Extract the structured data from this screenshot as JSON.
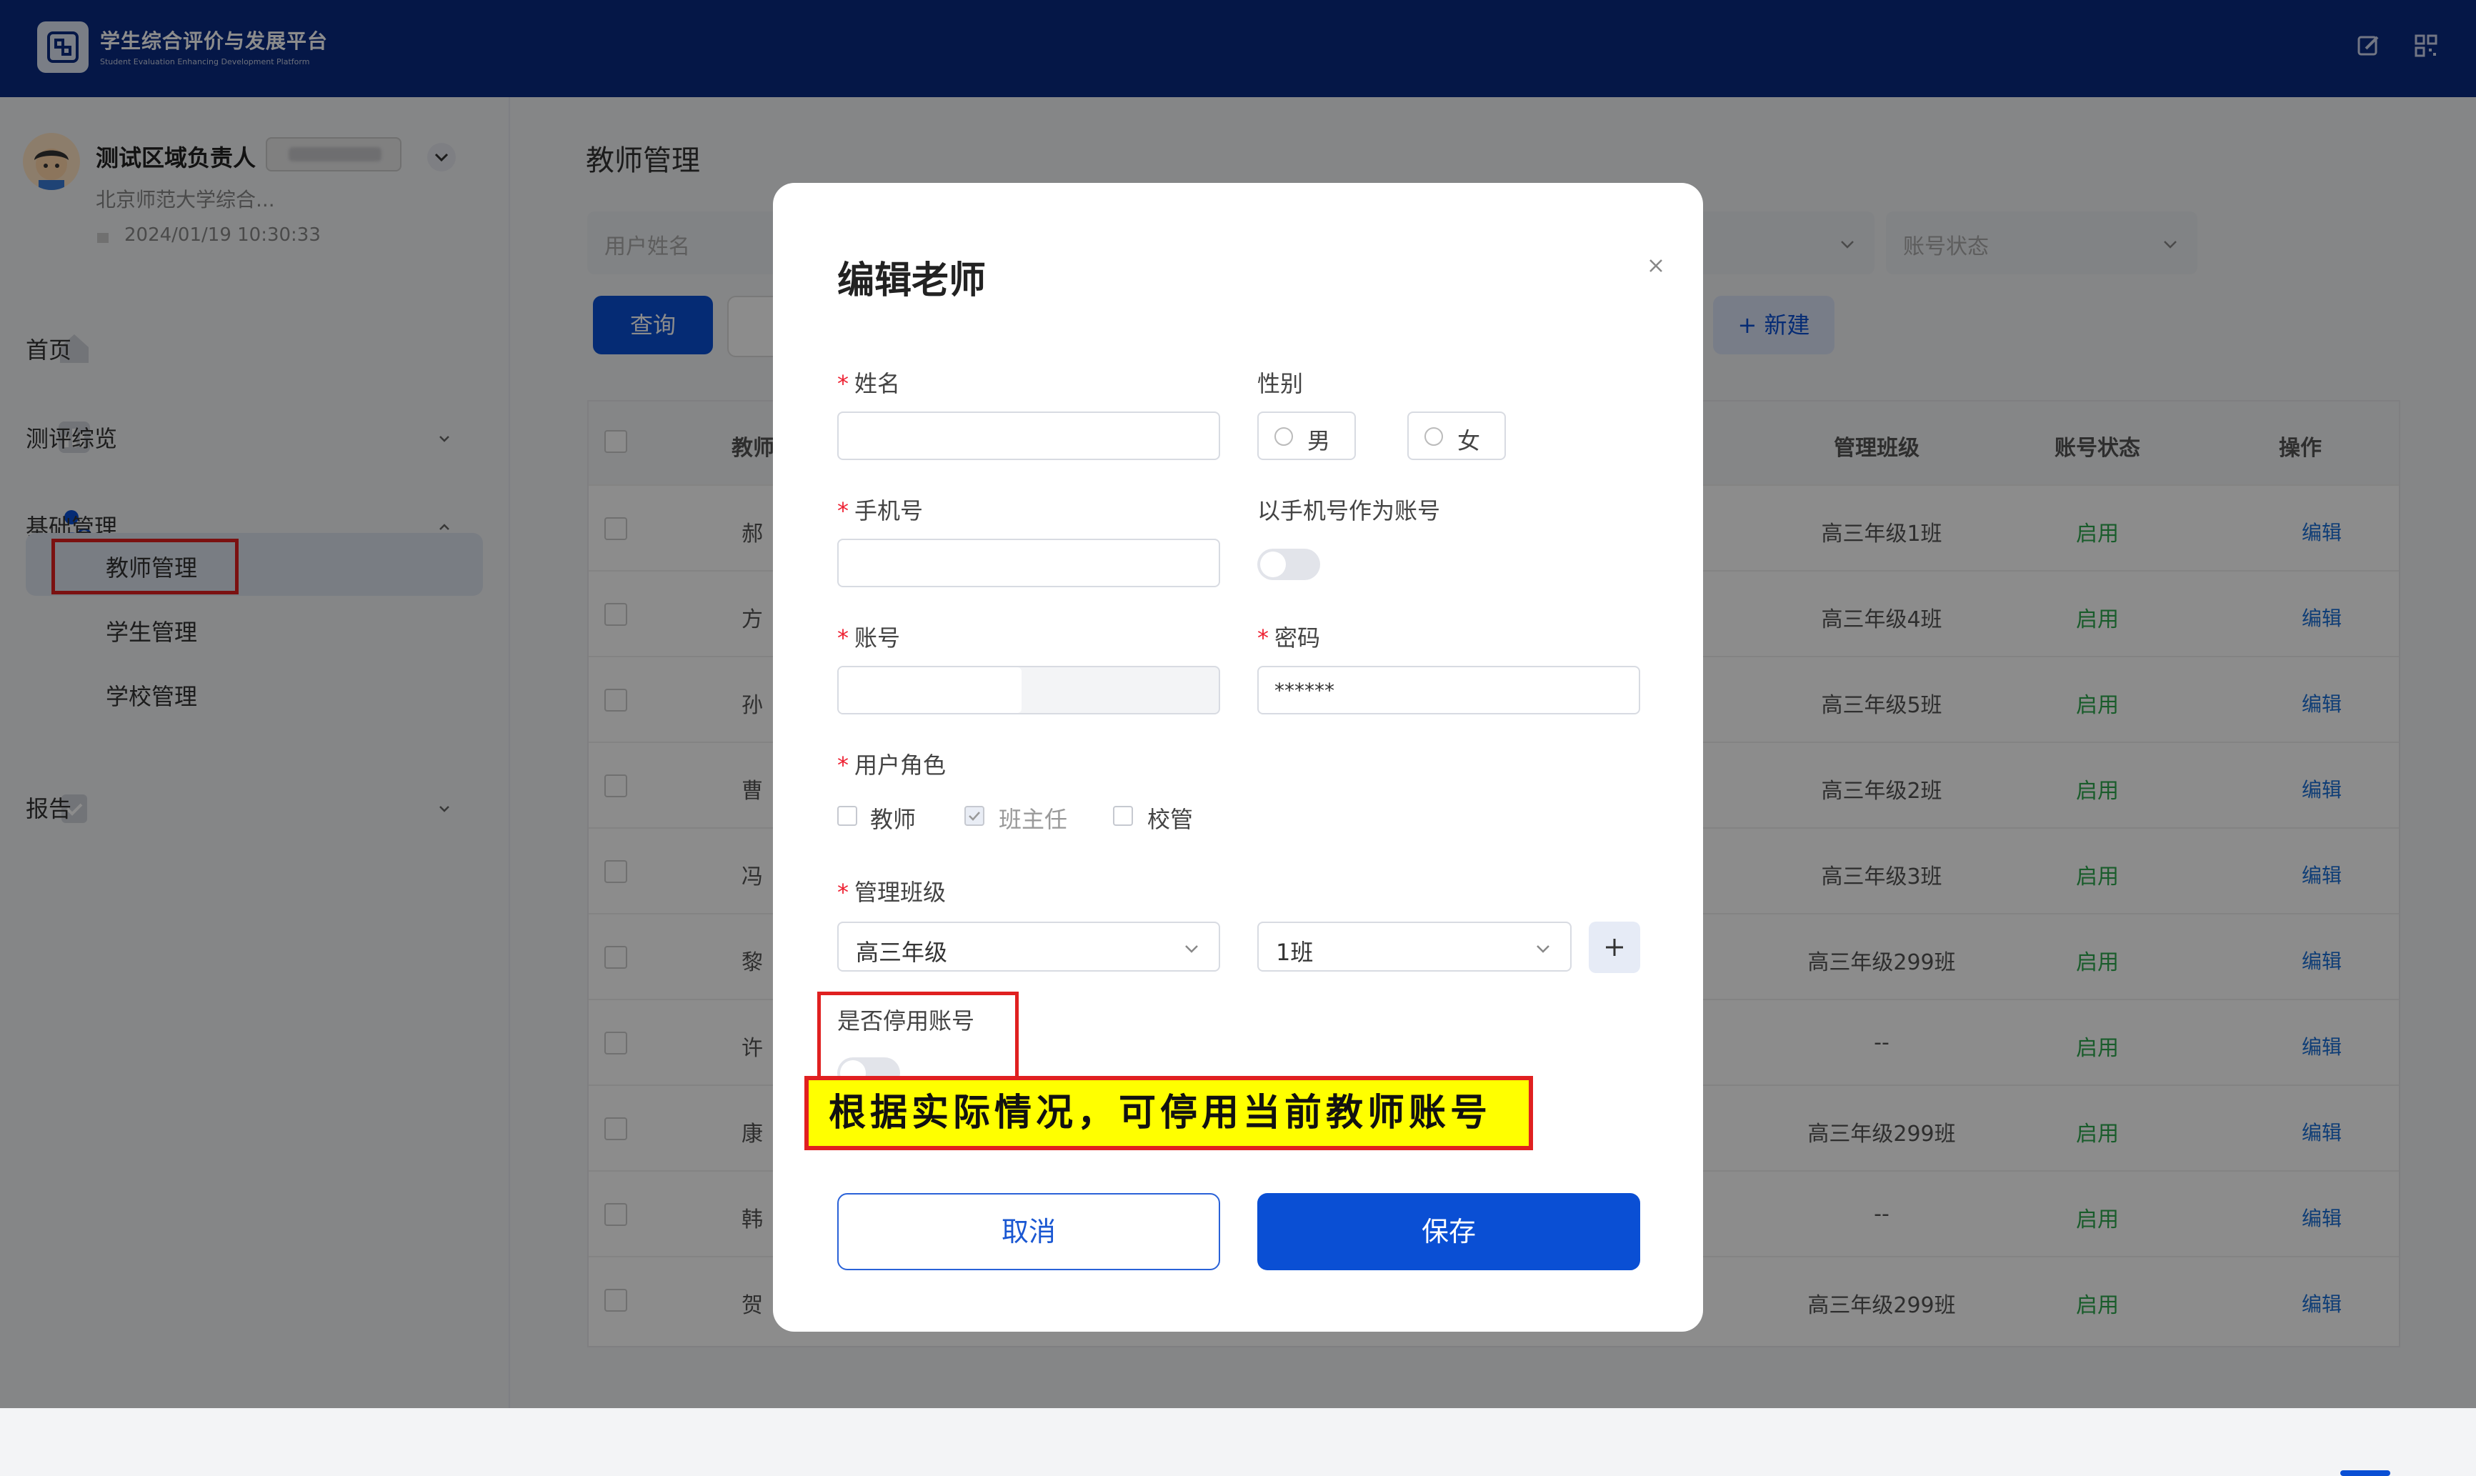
{
  "header": {
    "app_name": "学生综合评价与发展平台",
    "app_subtitle": "Student Evaluation Enhancing Development Platform"
  },
  "user": {
    "name": "测试区域负责人",
    "school": "北京师范大学综合...",
    "date": "2024/01/19 10:30:33"
  },
  "sidebar": {
    "items": [
      {
        "label": "首页"
      },
      {
        "label": "测评综览"
      },
      {
        "label": "基础管理"
      },
      {
        "label": "报告"
      }
    ],
    "sub_items": [
      {
        "label": "教师管理"
      },
      {
        "label": "学生管理"
      },
      {
        "label": "学校管理"
      }
    ]
  },
  "page": {
    "title": "教师管理",
    "filters": {
      "name_placeholder": "用户姓名",
      "status_placeholder": "账号状态"
    },
    "buttons": {
      "query": "查询",
      "new": "+ 新建"
    },
    "columns": [
      "教师",
      "管理班级",
      "账号状态",
      "操作"
    ],
    "rows": [
      {
        "name": "郝",
        "class": "高三年级1班",
        "status": "启用",
        "action": "编辑"
      },
      {
        "name": "方",
        "class": "高三年级4班",
        "status": "启用",
        "action": "编辑"
      },
      {
        "name": "孙",
        "class": "高三年级5班",
        "status": "启用",
        "action": "编辑"
      },
      {
        "name": "曹",
        "class": "高三年级2班",
        "status": "启用",
        "action": "编辑"
      },
      {
        "name": "冯",
        "class": "高三年级3班",
        "status": "启用",
        "action": "编辑"
      },
      {
        "name": "黎",
        "class": "高三年级299班",
        "status": "启用",
        "action": "编辑"
      },
      {
        "name": "许",
        "class": "--",
        "status": "启用",
        "action": "编辑"
      },
      {
        "name": "康",
        "class": "高三年级299班",
        "status": "启用",
        "action": "编辑"
      },
      {
        "name": "韩",
        "class": "--",
        "status": "启用",
        "action": "编辑"
      },
      {
        "name": "贺",
        "class": "高三年级299班",
        "status": "启用",
        "action": "编辑"
      }
    ]
  },
  "modal": {
    "title": "编辑老师",
    "fields": {
      "name_label": "姓名",
      "gender_label": "性别",
      "gender_male": "男",
      "gender_female": "女",
      "phone_label": "手机号",
      "phone_as_account_label": "以手机号作为账号",
      "account_label": "账号",
      "password_label": "密码",
      "password_value": "******",
      "role_label": "用户角色",
      "role_teacher": "教师",
      "role_headteacher": "班主任",
      "role_admin": "校管",
      "class_label": "管理班级",
      "grade_value": "高三年级",
      "class_value": "1班",
      "disable_label": "是否停用账号"
    },
    "buttons": {
      "cancel": "取消",
      "save": "保存"
    }
  },
  "annotation": {
    "text": "根据实际情况，可停用当前教师账号"
  },
  "colors": {
    "header_bg": "#0a2a82",
    "primary": "#0a4fd4",
    "status_enabled": "#2fa84f",
    "highlight_red": "#e02020",
    "annotation_yellow": "#ffff00"
  }
}
